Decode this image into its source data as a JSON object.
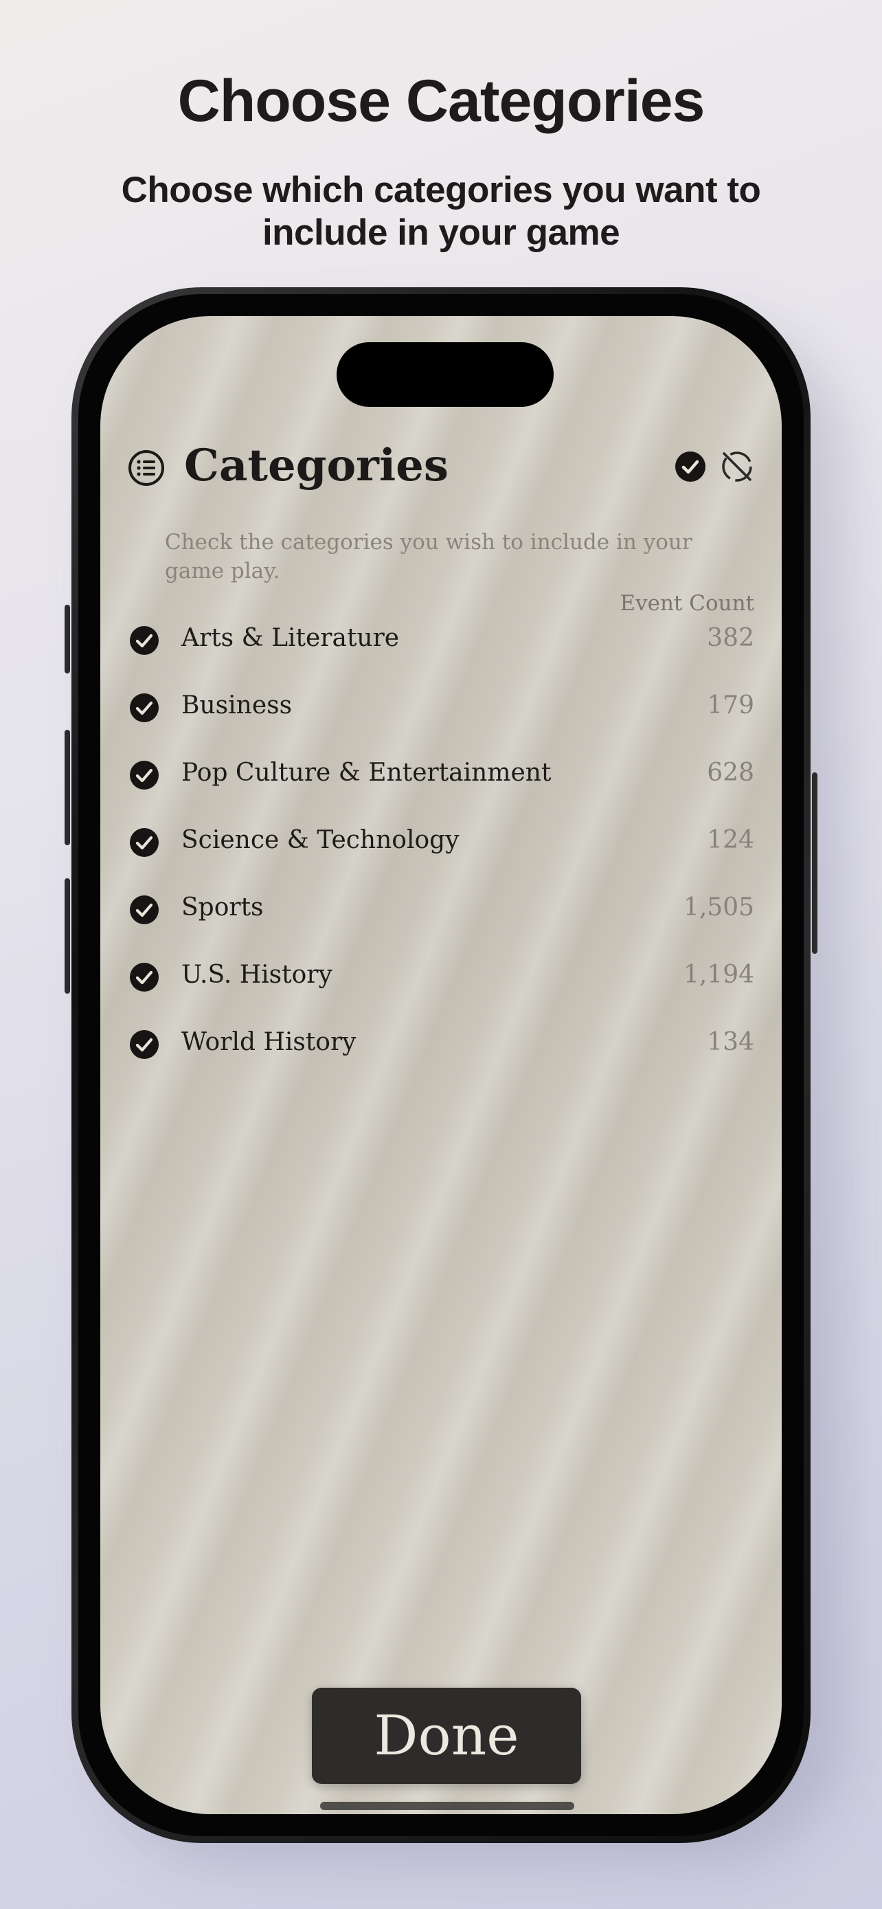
{
  "promo": {
    "headline": "Choose Categories",
    "subheadline": "Choose which categories you want to include in your game"
  },
  "screen": {
    "nav": {
      "menu_icon": "list-icon",
      "title": "Categories",
      "select_all_icon": "checkmark-circle-filled-icon",
      "deselect_all_icon": "circle-slash-icon"
    },
    "instructions": "Check the categories you wish to include in your game play.",
    "column_header": "Event Count",
    "categories": [
      {
        "label": "Arts & Literature",
        "count": "382",
        "checked": true
      },
      {
        "label": "Business",
        "count": "179",
        "checked": true
      },
      {
        "label": "Pop Culture & Entertainment",
        "count": "628",
        "checked": true
      },
      {
        "label": "Science & Technology",
        "count": "124",
        "checked": true
      },
      {
        "label": "Sports",
        "count": "1,505",
        "checked": true
      },
      {
        "label": "U.S. History",
        "count": "1,194",
        "checked": true
      },
      {
        "label": "World History",
        "count": "134",
        "checked": true
      }
    ],
    "done_label": "Done"
  },
  "colors": {
    "text_dark": "#1d1b1c",
    "screen_bg": "#cfcbc0",
    "button_bg": "#2d2c2a",
    "muted_text": "#86827a"
  }
}
